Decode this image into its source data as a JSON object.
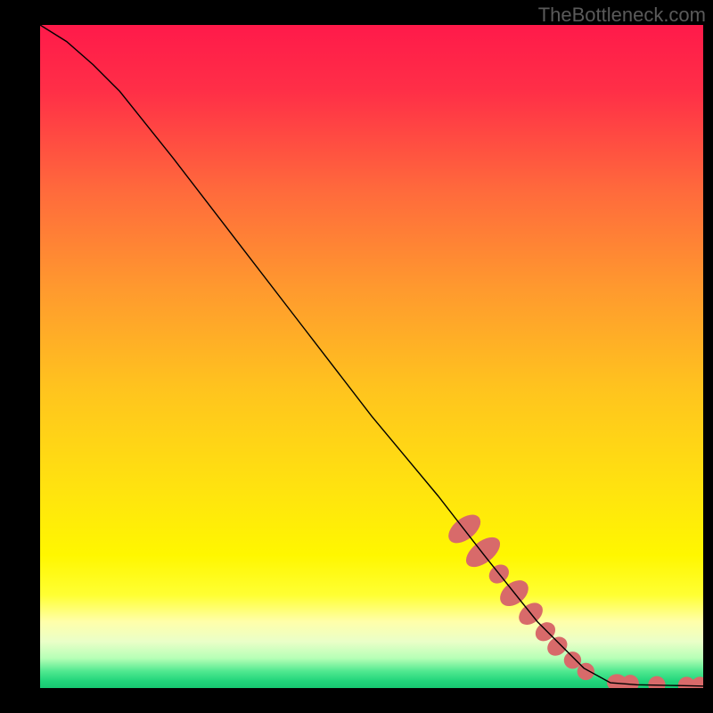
{
  "watermark": "TheBottleneck.com",
  "chart_data": {
    "type": "line",
    "title": "",
    "xlabel": "",
    "ylabel": "",
    "xlim": [
      0,
      100
    ],
    "ylim": [
      0,
      100
    ],
    "grid": false,
    "curve": [
      {
        "x": 0.0,
        "y": 100.0
      },
      {
        "x": 4.0,
        "y": 97.5
      },
      {
        "x": 8.0,
        "y": 94.0
      },
      {
        "x": 12.0,
        "y": 90.0
      },
      {
        "x": 20.0,
        "y": 80.0
      },
      {
        "x": 30.0,
        "y": 67.0
      },
      {
        "x": 40.0,
        "y": 54.0
      },
      {
        "x": 50.0,
        "y": 41.0
      },
      {
        "x": 60.0,
        "y": 29.0
      },
      {
        "x": 67.0,
        "y": 20.0
      },
      {
        "x": 75.0,
        "y": 10.0
      },
      {
        "x": 82.0,
        "y": 3.0
      },
      {
        "x": 86.0,
        "y": 0.8
      },
      {
        "x": 90.0,
        "y": 0.5
      },
      {
        "x": 95.0,
        "y": 0.4
      },
      {
        "x": 100.0,
        "y": 0.3
      }
    ],
    "highlight_segments": [
      {
        "cx": 64.0,
        "cy": 24.0,
        "rx": 1.6,
        "ry": 2.8,
        "rot": 52
      },
      {
        "cx": 66.8,
        "cy": 20.5,
        "rx": 1.6,
        "ry": 3.0,
        "rot": 52
      },
      {
        "cx": 69.2,
        "cy": 17.2,
        "rx": 1.3,
        "ry": 1.6,
        "rot": 52
      },
      {
        "cx": 71.5,
        "cy": 14.3,
        "rx": 1.6,
        "ry": 2.4,
        "rot": 52
      },
      {
        "cx": 74.0,
        "cy": 11.2,
        "rx": 1.4,
        "ry": 2.0,
        "rot": 52
      },
      {
        "cx": 76.2,
        "cy": 8.5,
        "rx": 1.3,
        "ry": 1.6,
        "rot": 52
      },
      {
        "cx": 78.0,
        "cy": 6.3,
        "rx": 1.3,
        "ry": 1.6,
        "rot": 52
      },
      {
        "cx": 80.3,
        "cy": 4.2,
        "rx": 1.3,
        "ry": 1.3,
        "rot": 48
      },
      {
        "cx": 82.3,
        "cy": 2.5,
        "rx": 1.3,
        "ry": 1.3,
        "rot": 40
      },
      {
        "cx": 87.0,
        "cy": 0.8,
        "rx": 1.5,
        "ry": 1.3,
        "rot": 0
      },
      {
        "cx": 89.0,
        "cy": 0.7,
        "rx": 1.3,
        "ry": 1.3,
        "rot": 0
      },
      {
        "cx": 93.0,
        "cy": 0.5,
        "rx": 1.3,
        "ry": 1.3,
        "rot": 0
      },
      {
        "cx": 97.5,
        "cy": 0.4,
        "rx": 1.3,
        "ry": 1.3,
        "rot": 0
      },
      {
        "cx": 99.5,
        "cy": 0.4,
        "rx": 1.3,
        "ry": 1.3,
        "rot": 0
      }
    ],
    "gradient_stops": [
      {
        "offset": 0,
        "color": "#ff1a4a"
      },
      {
        "offset": 0.1,
        "color": "#ff2f47"
      },
      {
        "offset": 0.25,
        "color": "#ff6a3c"
      },
      {
        "offset": 0.4,
        "color": "#ff9a2e"
      },
      {
        "offset": 0.55,
        "color": "#ffc41e"
      },
      {
        "offset": 0.7,
        "color": "#ffe30f"
      },
      {
        "offset": 0.8,
        "color": "#fff700"
      },
      {
        "offset": 0.86,
        "color": "#ffff33"
      },
      {
        "offset": 0.9,
        "color": "#ffffaa"
      },
      {
        "offset": 0.93,
        "color": "#eaffc8"
      },
      {
        "offset": 0.955,
        "color": "#b6ffb6"
      },
      {
        "offset": 0.975,
        "color": "#4fe88f"
      },
      {
        "offset": 0.99,
        "color": "#20d47a"
      },
      {
        "offset": 1.0,
        "color": "#18c872"
      }
    ],
    "highlight_color": "#d86a6a",
    "curve_color": "#000000"
  }
}
